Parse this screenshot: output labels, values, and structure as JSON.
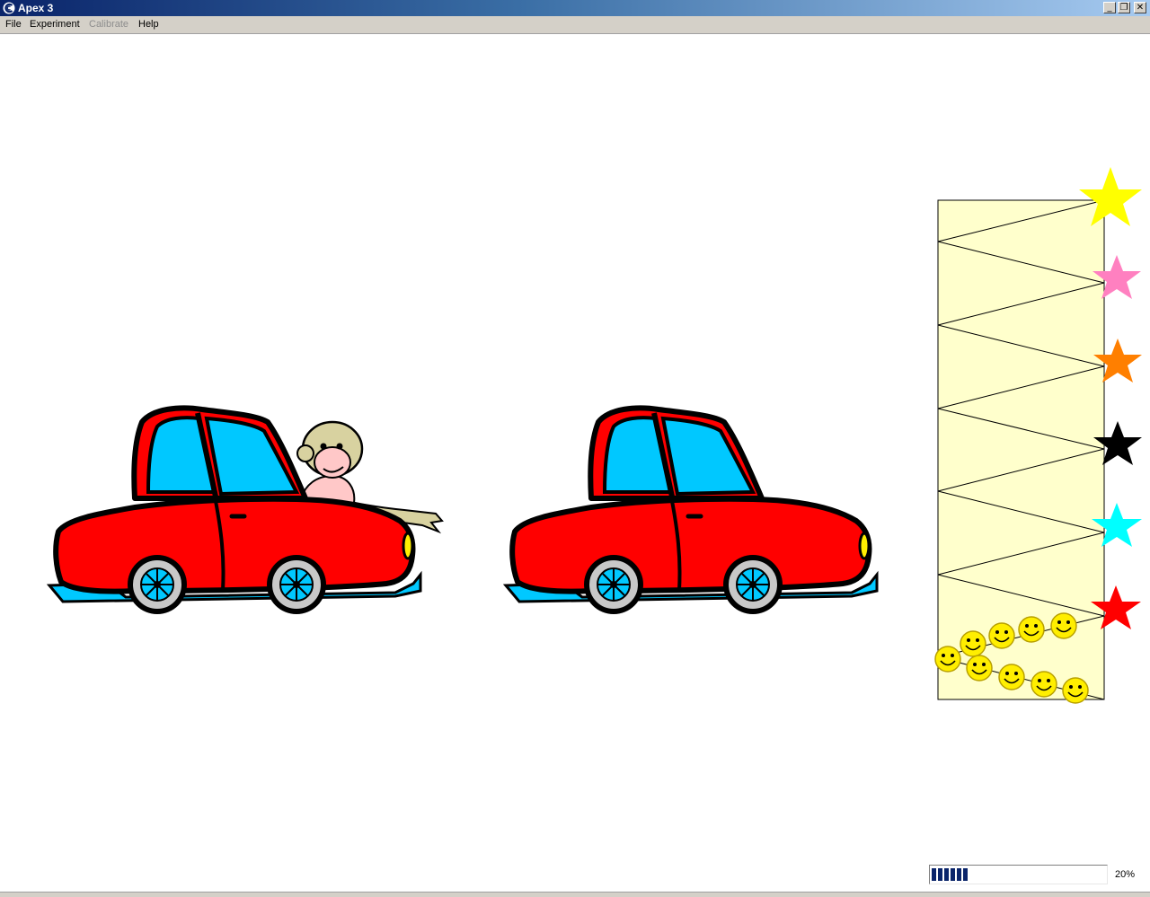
{
  "window": {
    "title": "Apex 3",
    "controls": {
      "minimize": "_",
      "maximize": "❐",
      "close": "✕"
    }
  },
  "menu": {
    "items": [
      {
        "label": "File",
        "enabled": true
      },
      {
        "label": "Experiment",
        "enabled": true
      },
      {
        "label": "Calibrate",
        "enabled": false
      },
      {
        "label": "Help",
        "enabled": false
      }
    ]
  },
  "scene": {
    "cars": [
      {
        "id": "left-car",
        "has_monkey": true,
        "body_color": "#ff0000",
        "window_color": "#00c8ff"
      },
      {
        "id": "right-car",
        "has_monkey": false,
        "body_color": "#ff0000",
        "window_color": "#00c8ff"
      }
    ],
    "reward_column": {
      "background": "#ffffcc",
      "stars": [
        {
          "color": "#ffff00",
          "name": "yellow"
        },
        {
          "color": "#ff80c0",
          "name": "pink"
        },
        {
          "color": "#ff7f00",
          "name": "orange"
        },
        {
          "color": "#000000",
          "name": "black"
        },
        {
          "color": "#00ffff",
          "name": "cyan"
        },
        {
          "color": "#ff0000",
          "name": "red"
        }
      ],
      "smiley_count": 10,
      "smiley_color": "#ffee00"
    }
  },
  "progress": {
    "value_fraction": 0.2,
    "label": "20%"
  }
}
